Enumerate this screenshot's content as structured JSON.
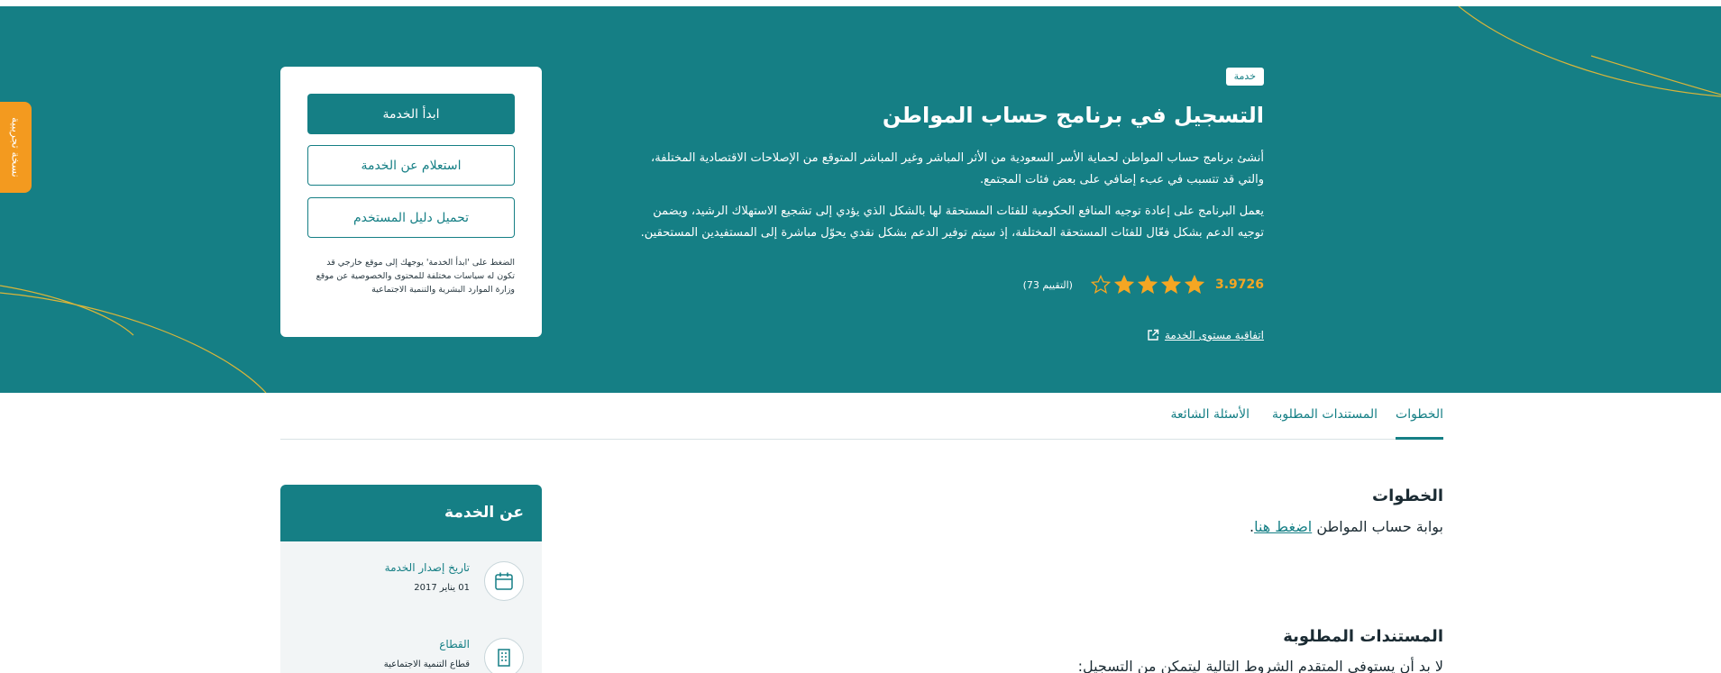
{
  "beta_tab": {
    "label": "نسخة تجريبية"
  },
  "hero": {
    "badge": "خدمة",
    "title": "التسجيل في برنامج حساب المواطن",
    "paragraph_1": "أنشئ برنامج حساب المواطن لحماية  الأسر السعودية من الأثر المباشر وغير المباشر المتوقع من الإصلاحات الاقتصادية المختلفة، والتي قد تتسبب في عبء إضافي على بعض فئات المجتمع.",
    "paragraph_2": "يعمل البرنامج على إعادة توجيه المنافع الحكومية للفئات المستحقة لها بالشكل الذي يؤدي إلى تشجيع الاستهلاك الرشيد، ويضمن توجيه الدعم بشكل فعّال للفئات المستحقة المختلفة، إذ سيتم توفير الدعم بشكل نقدي يحوّل مباشرة إلى المستفيدين المستحقين.",
    "rating_score": "3.9726",
    "rating_count": "(التقييم 73)",
    "stars": {
      "filled": 4,
      "total": 5
    },
    "quality_link": "اتفاقية مستوى الخدمة"
  },
  "card": {
    "start_button": "ابدأ الخدمة",
    "inquiry_button": "استعلام عن الخدمة",
    "guide_button": "تحميل دليل المستخدم",
    "note": "الضغط على 'ابدأ الخدمة' يوجهك إلى موقع خارجي قد تكون له سياسات مختلفة للمحتوى والخصوصية عن موقع وزارة الموارد البشرية والتنمية الاجتماعية"
  },
  "tabs": [
    {
      "label": "الخطوات"
    },
    {
      "label": "المستندات المطلوبة"
    },
    {
      "label": "الأسئلة الشائعة"
    }
  ],
  "about": {
    "title": "عن الخدمة",
    "items": [
      {
        "label": "تاريخ إصدار الخدمة",
        "value": "01 يناير 2017",
        "icon": "calendar-icon"
      },
      {
        "label": "القطاع",
        "value": "قطاع التنمية الاجتماعية",
        "icon": "building-icon"
      }
    ]
  },
  "steps": {
    "title": "الخطوات",
    "text": "بوابة حساب المواطن",
    "link": "اضغط هنا",
    "suffix": "."
  },
  "documents": {
    "title": "المستندات المطلوبة",
    "text": "لا بد أن يستوفي المتقدم الشروط التالية ليتمكن من التسجيل:"
  },
  "colors": {
    "primary": "#157f85",
    "accent": "#f39a1f",
    "star": "#f5a623"
  }
}
